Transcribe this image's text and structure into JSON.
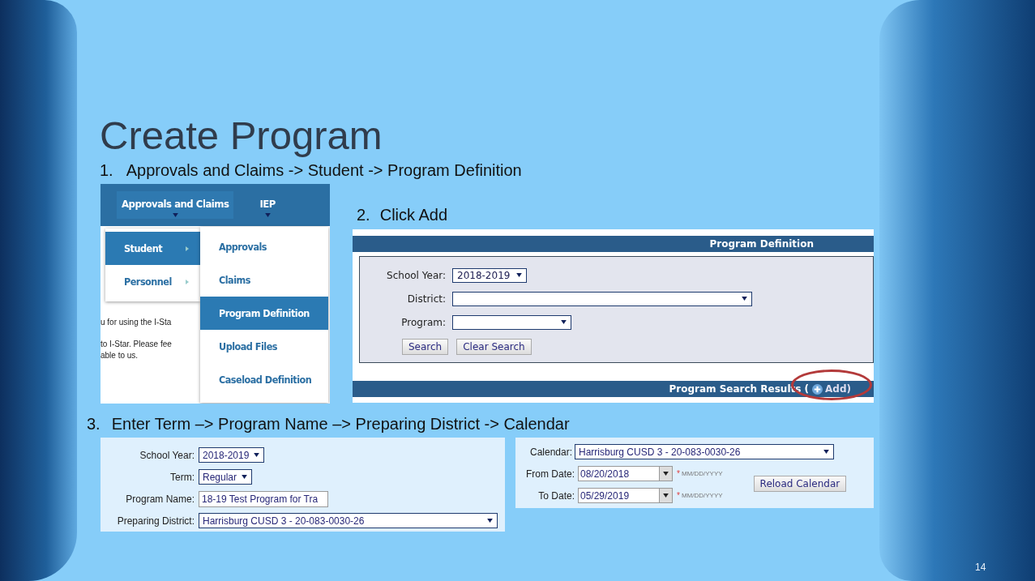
{
  "title": "Create Program",
  "step_1": {
    "number": "1.",
    "text": "Approvals and Claims -> Student -> Program Definition"
  },
  "menu_screenshot": {
    "nav_items": [
      {
        "label": "Approvals and Claims",
        "selected": true
      },
      {
        "label": "IEP",
        "selected": false
      }
    ],
    "submenu": [
      {
        "label": "Student",
        "selected": true
      },
      {
        "label": "Personnel",
        "selected": false
      }
    ],
    "flyout": [
      {
        "label": "Approvals",
        "selected": false
      },
      {
        "label": "Claims",
        "selected": false
      },
      {
        "label": "Program Definition",
        "selected": true
      },
      {
        "label": "Upload Files",
        "selected": false
      },
      {
        "label": "Caseload Definition",
        "selected": false
      }
    ],
    "page_texts": [
      "u for using the I-Sta",
      "to I-Star. Please fee",
      "able to us."
    ]
  },
  "step_2": {
    "number": "2.",
    "text": "Click Add"
  },
  "search_screenshot": {
    "header": "Program Definition",
    "fields": [
      {
        "label": "School Year:",
        "value": "2018-2019"
      },
      {
        "label": "District:"
      },
      {
        "label": "Program:"
      }
    ],
    "buttons": [
      "Search",
      "Clear Search"
    ],
    "results_header": "Program Search Results (",
    "add_link": "Add)",
    "highlighted": true
  },
  "step_3": {
    "number": "3.",
    "text": "Enter Term –> Program Name –> Preparing District -> Calendar"
  },
  "program_form": [
    {
      "label": "School Year:",
      "value": "2018-2019",
      "kind": "select"
    },
    {
      "label": "Term:",
      "value": "Regular",
      "kind": "select"
    },
    {
      "label": "Program Name:",
      "value": "18-19 Test Program for Tra",
      "kind": "text"
    },
    {
      "label": "Preparing District:",
      "value": "Harrisburg CUSD 3 - 20-083-0030-26",
      "kind": "select"
    }
  ],
  "calendar_form": {
    "calendar": {
      "label": "Calendar:",
      "value": "Harrisburg CUSD 3 - 20-083-0030-26"
    },
    "dates": [
      {
        "label": "From Date:",
        "value": "08/20/2018",
        "required_mark": "*",
        "hint": "MM/DD/YYYY"
      },
      {
        "label": "To Date:",
        "value": "05/29/2019",
        "required_mark": "*",
        "hint": "MM/DD/YYYY"
      }
    ],
    "button": "Reload Calendar"
  },
  "page_number": "14"
}
